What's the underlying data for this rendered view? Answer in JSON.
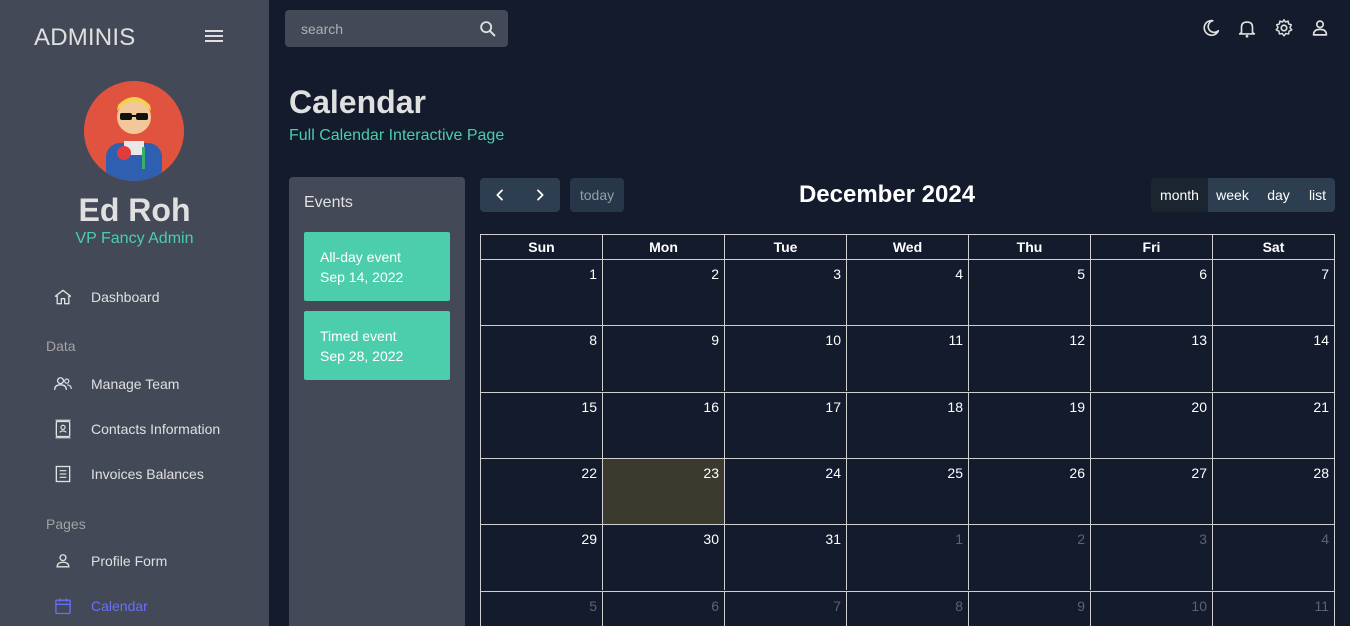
{
  "brand": "ADMINIS",
  "profile": {
    "name": "Ed Roh",
    "role": "VP Fancy Admin"
  },
  "sidebar": {
    "items": [
      {
        "label": "Dashboard",
        "icon": "home-icon"
      },
      {
        "label": "Manage Team",
        "icon": "people-icon"
      },
      {
        "label": "Contacts Information",
        "icon": "contacts-icon"
      },
      {
        "label": "Invoices Balances",
        "icon": "receipt-icon"
      },
      {
        "label": "Profile Form",
        "icon": "person-icon"
      },
      {
        "label": "Calendar",
        "icon": "calendar-icon",
        "active": true
      }
    ],
    "sections": [
      "Data",
      "Pages"
    ]
  },
  "search": {
    "placeholder": "search"
  },
  "topbar": {
    "icons": [
      "moon-icon",
      "bell-icon",
      "gear-icon",
      "user-icon"
    ]
  },
  "header": {
    "title": "Calendar",
    "subtitle": "Full Calendar Interactive Page"
  },
  "events": {
    "title": "Events",
    "items": [
      {
        "title": "All-day event",
        "date": "Sep 14, 2022"
      },
      {
        "title": "Timed event",
        "date": "Sep 28, 2022"
      }
    ]
  },
  "calendar": {
    "title": "December 2024",
    "today_label": "today",
    "views": [
      "month",
      "week",
      "day",
      "list"
    ],
    "active_view": "month",
    "weekdays": [
      "Sun",
      "Mon",
      "Tue",
      "Wed",
      "Thu",
      "Fri",
      "Sat"
    ],
    "today": "23",
    "weeks": [
      [
        "1",
        "2",
        "3",
        "4",
        "5",
        "6",
        "7"
      ],
      [
        "8",
        "9",
        "10",
        "11",
        "12",
        "13",
        "14"
      ],
      [
        "15",
        "16",
        "17",
        "18",
        "19",
        "20",
        "21"
      ],
      [
        "22",
        "23",
        "24",
        "25",
        "26",
        "27",
        "28"
      ],
      [
        "29",
        "30",
        "31",
        "1",
        "2",
        "3",
        "4"
      ],
      [
        "5",
        "6",
        "7",
        "8",
        "9",
        "10",
        "11"
      ]
    ],
    "other_month": [
      [
        false,
        false,
        false,
        false,
        false,
        false,
        false
      ],
      [
        false,
        false,
        false,
        false,
        false,
        false,
        false
      ],
      [
        false,
        false,
        false,
        false,
        false,
        false,
        false
      ],
      [
        false,
        false,
        false,
        false,
        false,
        false,
        false
      ],
      [
        false,
        false,
        false,
        true,
        true,
        true,
        true
      ],
      [
        true,
        true,
        true,
        true,
        true,
        true,
        true
      ]
    ]
  },
  "colors": {
    "accent": "#4cceac",
    "active_nav": "#6870fa",
    "today_bg": "#3a3a2e"
  }
}
